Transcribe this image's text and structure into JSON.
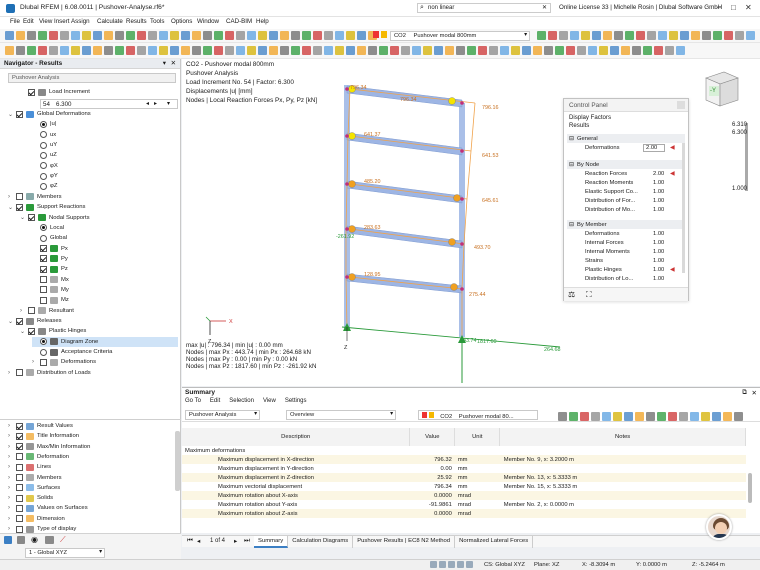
{
  "window": {
    "title": "Dlubal RFEM | 6.08.0011 | Pushover-Analyse.rf6*",
    "search": "non linear",
    "license": "Online License 33 | Michelle Rosin | Dlubal Software GmbH"
  },
  "menu": [
    "File",
    "Edit",
    "View",
    "Insert",
    "Assign",
    "Calculate",
    "Results",
    "Tools",
    "Options",
    "Window",
    "CAD-BIM",
    "Help"
  ],
  "toolbar": {
    "lc_code": "CO2",
    "lc_name": "Pushover modal 800mm"
  },
  "navigator": {
    "title": "Navigator - Results",
    "combo": "Pushover Analysis",
    "items": [
      {
        "label": "Load Increment",
        "lvl": 1,
        "ctl": "cb",
        "on": true,
        "exp": "",
        "icon": "#888"
      },
      {
        "label": "Global Deformations",
        "lvl": 0,
        "ctl": "cb",
        "on": true,
        "exp": "v",
        "icon": "#4a8fd8"
      },
      {
        "label": "|u|",
        "lvl": 2,
        "ctl": "rd",
        "on": true,
        "exp": "",
        "icon": ""
      },
      {
        "label": "ux",
        "lvl": 2,
        "ctl": "rd",
        "on": false,
        "exp": "",
        "icon": ""
      },
      {
        "label": "uY",
        "lvl": 2,
        "ctl": "rd",
        "on": false,
        "exp": "",
        "icon": ""
      },
      {
        "label": "uZ",
        "lvl": 2,
        "ctl": "rd",
        "on": false,
        "exp": "",
        "icon": ""
      },
      {
        "label": "φX",
        "lvl": 2,
        "ctl": "rd",
        "on": false,
        "exp": "",
        "icon": ""
      },
      {
        "label": "φY",
        "lvl": 2,
        "ctl": "rd",
        "on": false,
        "exp": "",
        "icon": ""
      },
      {
        "label": "φZ",
        "lvl": 2,
        "ctl": "rd",
        "on": false,
        "exp": "",
        "icon": ""
      },
      {
        "label": "Members",
        "lvl": 0,
        "ctl": "cb",
        "on": false,
        "exp": ">",
        "icon": "#8aa"
      },
      {
        "label": "Support Reactions",
        "lvl": 0,
        "ctl": "cb",
        "on": true,
        "exp": "v",
        "icon": "#2a9a3a"
      },
      {
        "label": "Nodal Supports",
        "lvl": 1,
        "ctl": "cb",
        "on": true,
        "exp": "v",
        "icon": "#2a9a3a"
      },
      {
        "label": "Local",
        "lvl": 2,
        "ctl": "rd",
        "on": true,
        "exp": "",
        "icon": ""
      },
      {
        "label": "Global",
        "lvl": 2,
        "ctl": "rd",
        "on": false,
        "exp": "",
        "icon": ""
      },
      {
        "label": "Px",
        "lvl": 2,
        "ctl": "cb",
        "on": true,
        "exp": "",
        "icon": "#2a9a3a"
      },
      {
        "label": "Py",
        "lvl": 2,
        "ctl": "cb",
        "on": true,
        "exp": "",
        "icon": "#2a9a3a"
      },
      {
        "label": "Pz",
        "lvl": 2,
        "ctl": "cb",
        "on": true,
        "exp": "",
        "icon": "#2a9a3a"
      },
      {
        "label": "Mx",
        "lvl": 2,
        "ctl": "cb",
        "on": false,
        "exp": "",
        "icon": "#aaa"
      },
      {
        "label": "My",
        "lvl": 2,
        "ctl": "cb",
        "on": false,
        "exp": "",
        "icon": "#aaa"
      },
      {
        "label": "Mz",
        "lvl": 2,
        "ctl": "cb",
        "on": false,
        "exp": "",
        "icon": "#aaa"
      },
      {
        "label": "Resultant",
        "lvl": 1,
        "ctl": "cb",
        "on": false,
        "exp": ">",
        "icon": "#aaa"
      },
      {
        "label": "Releases",
        "lvl": 0,
        "ctl": "cb",
        "on": true,
        "exp": "v",
        "icon": "#888"
      },
      {
        "label": "Plastic Hinges",
        "lvl": 1,
        "ctl": "cb",
        "on": true,
        "exp": "v",
        "icon": "#888"
      },
      {
        "label": "Diagram Zone",
        "lvl": 2,
        "ctl": "rd",
        "on": true,
        "exp": "",
        "icon": "#666",
        "sel": true
      },
      {
        "label": "Acceptance Criteria",
        "lvl": 2,
        "ctl": "rd",
        "on": false,
        "exp": "",
        "icon": "#666"
      },
      {
        "label": "Deformations",
        "lvl": 2,
        "ctl": "cb",
        "on": false,
        "exp": ">",
        "icon": "#aaa"
      },
      {
        "label": "Distribution of Loads",
        "lvl": 0,
        "ctl": "cb",
        "on": false,
        "exp": ">",
        "icon": "#aaa"
      }
    ],
    "increment": {
      "num": "54",
      "val": "6.300"
    },
    "bottom_items": [
      "Result Values",
      "Title Information",
      "Max/Min Information",
      "Deformation",
      "Lines",
      "Members",
      "Surfaces",
      "Solids",
      "Values on Surfaces",
      "Dimension",
      "Type of display"
    ],
    "bottom_checked": [
      true,
      true,
      true,
      false,
      false,
      false,
      false,
      false,
      false,
      false,
      false
    ],
    "view_combo": "1 - Global XYZ"
  },
  "view": {
    "info": [
      "CO2 - Pushover modal 800mm",
      "Pushover Analysis",
      "Load Increment No. 54 | Factor: 6.300",
      "Displacements |u| [mm]",
      "Nodes | Local Reaction Forces Px, Py, Pz [kN]"
    ],
    "maxmin": [
      "max |u| : 796.34 | min |u| : 0.00 mm",
      "Nodes | max Px : 443.74 | min Px : 264.68 kN",
      "Nodes | max Py : 0.00 | min Py : 0.00 kN",
      "Nodes | max Pz : 1817.60 | min Pz : -261.92 kN"
    ],
    "labels": [
      {
        "t": "796.34"
      },
      {
        "t": "796.34"
      },
      {
        "t": "796.16"
      },
      {
        "t": "641.37"
      },
      {
        "t": "641.53"
      },
      {
        "t": "485.20"
      },
      {
        "t": "645.61"
      },
      {
        "t": "283.63"
      },
      {
        "t": "493.70"
      },
      {
        "t": "-261.92"
      },
      {
        "t": "128.95"
      },
      {
        "t": "275.44"
      },
      {
        "t": "1817.60"
      },
      {
        "t": "443.74"
      },
      {
        "t": "264.68"
      }
    ],
    "axis": {
      "x": "X",
      "z": "Z"
    },
    "scale": [
      "6.310",
      "6.300",
      "1.000"
    ],
    "cube_label": "-Y"
  },
  "control_panel": {
    "title": "Control Panel",
    "sub1": "Display Factors",
    "sub2": "Results",
    "general_title": "General",
    "deformations_label": "Deformations",
    "deformations_val": "2.00",
    "node_title": "By Node",
    "node_rows": [
      {
        "l": "Reaction Forces",
        "v": "2.00"
      },
      {
        "l": "Reaction Moments",
        "v": "1.00"
      },
      {
        "l": "Elastic Support Co...",
        "v": "1.00"
      },
      {
        "l": "Distribution of For...",
        "v": "1.00"
      },
      {
        "l": "Distribution of Mo...",
        "v": "1.00"
      }
    ],
    "member_title": "By Member",
    "member_rows": [
      {
        "l": "Deformations",
        "v": "1.00"
      },
      {
        "l": "Internal Forces",
        "v": "1.00"
      },
      {
        "l": "Internal Moments",
        "v": "1.00"
      },
      {
        "l": "Strains",
        "v": "1.00"
      },
      {
        "l": "Plastic Hinges",
        "v": "1.00"
      },
      {
        "l": "Distribution of Lo...",
        "v": "1.00"
      }
    ]
  },
  "summary": {
    "title": "Summary",
    "menu": [
      "Go To",
      "Edit",
      "Selection",
      "View",
      "Settings"
    ],
    "combo1": "Pushover Analysis",
    "combo2": "Overview",
    "lc_code": "CO2",
    "lc_name": "Pushover modal 80...",
    "cols": [
      "Description",
      "Value",
      "Unit",
      "Notes"
    ],
    "group": "Maximum deformations",
    "rows": [
      {
        "d": "Maximum displacement in X-direction",
        "v": "796.32",
        "u": "mm",
        "n": "Member No. 9, x: 3.2000 m"
      },
      {
        "d": "Maximum displacement in Y-direction",
        "v": "0.00",
        "u": "mm",
        "n": ""
      },
      {
        "d": "Maximum displacement in Z-direction",
        "v": "25.92",
        "u": "mm",
        "n": "Member No. 13, x: 5.3333 m"
      },
      {
        "d": "Maximum vectorial displacement",
        "v": "796.34",
        "u": "mm",
        "n": "Member No. 15, x: 5.3333 m"
      },
      {
        "d": "Maximum rotation about X-axis",
        "v": "0.0000",
        "u": "mrad",
        "n": ""
      },
      {
        "d": "Maximum rotation about Y-axis",
        "v": "-91.9861",
        "u": "mrad",
        "n": "Member No. 2, x: 0.0000 m"
      },
      {
        "d": "Maximum rotation about Z-axis",
        "v": "0.0000",
        "u": "mrad",
        "n": ""
      }
    ],
    "pager": "1 of 4",
    "tabs": [
      "Summary",
      "Calculation Diagrams",
      "Pushover Results | EC8 N2 Method",
      "Normalized Lateral Forces"
    ]
  },
  "status": {
    "cs": "CS: Global XYZ",
    "plane": "Plane: XZ",
    "x": "X: -8.3094 m",
    "y": "Y: 0.0000 m",
    "z": "Z: -5.2464 m"
  }
}
